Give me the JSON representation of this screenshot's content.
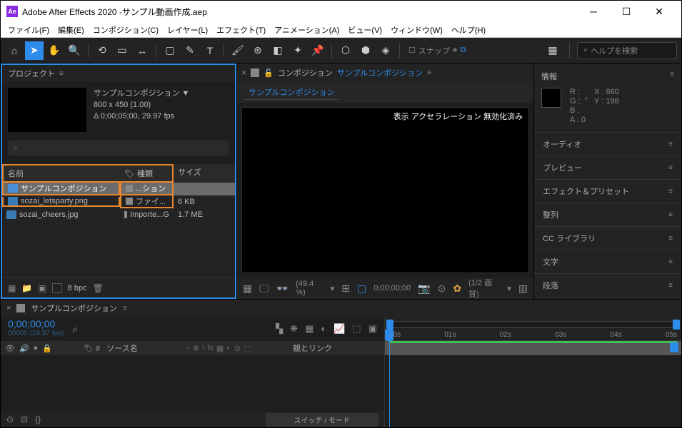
{
  "titlebar": {
    "app": "Adobe After Effects 2020 -サンプル動画作成.aep"
  },
  "menubar": [
    "ファイル(F)",
    "編集(E)",
    "コンポジション(C)",
    "レイヤー(L)",
    "エフェクト(T)",
    "アニメーション(A)",
    "ビュー(V)",
    "ウィンドウ(W)",
    "ヘルプ(H)"
  ],
  "toolbar": {
    "snap": "スナップ",
    "search_placeholder": "ヘルプを検索"
  },
  "project": {
    "title": "プロジェクト",
    "comp_name": "サンプルコンポジション ▼",
    "dims": "800 x 450 (1.00)",
    "duration": "Δ 0;00;05;00, 29.97 fps",
    "headers": {
      "name": "名前",
      "type": "種類",
      "size": "サイズ"
    },
    "items": [
      {
        "name": "サンプルコンポジション",
        "type": "...ション",
        "size": ""
      },
      {
        "name": "sozai_letsparty.png",
        "type": "ファイ...",
        "size": "6 KB"
      },
      {
        "name": "sozai_cheers.jpg",
        "type": "Importe...G",
        "size": "1.7 ME"
      }
    ],
    "footer_bpc": "8 bpc"
  },
  "composition": {
    "lock": "⬛",
    "tab_prefix": "コンポジション",
    "tab_name": "サンプルコンポジション",
    "sub_tab": "サンプルコンポジション",
    "overlay": "表示 アクセラレーション 無効化済み",
    "zoom": "(49.4 %)",
    "time": "0;00;00;00",
    "quality": "(1/2 画質)"
  },
  "info": {
    "title": "情報",
    "r": "R :",
    "g": "G :",
    "b": "B :",
    "a": "A :  0",
    "x": "X : 660",
    "y": "Y : 198"
  },
  "panels": [
    "オーディオ",
    "プレビュー",
    "エフェクト＆プリセット",
    "整列",
    "CC ライブラリ",
    "文字",
    "段落"
  ],
  "timeline": {
    "tab": "サンプルコンポジション",
    "time": "0;00;00;00",
    "time_sub": "00000 (29.97 fps)",
    "col_source": "ソース名",
    "col_parent": "親とリンク",
    "mode": "スイッチ / モード",
    "ticks": [
      "00s",
      "01s",
      "02s",
      "03s",
      "04s",
      "05s"
    ],
    "col_hash": "#"
  }
}
